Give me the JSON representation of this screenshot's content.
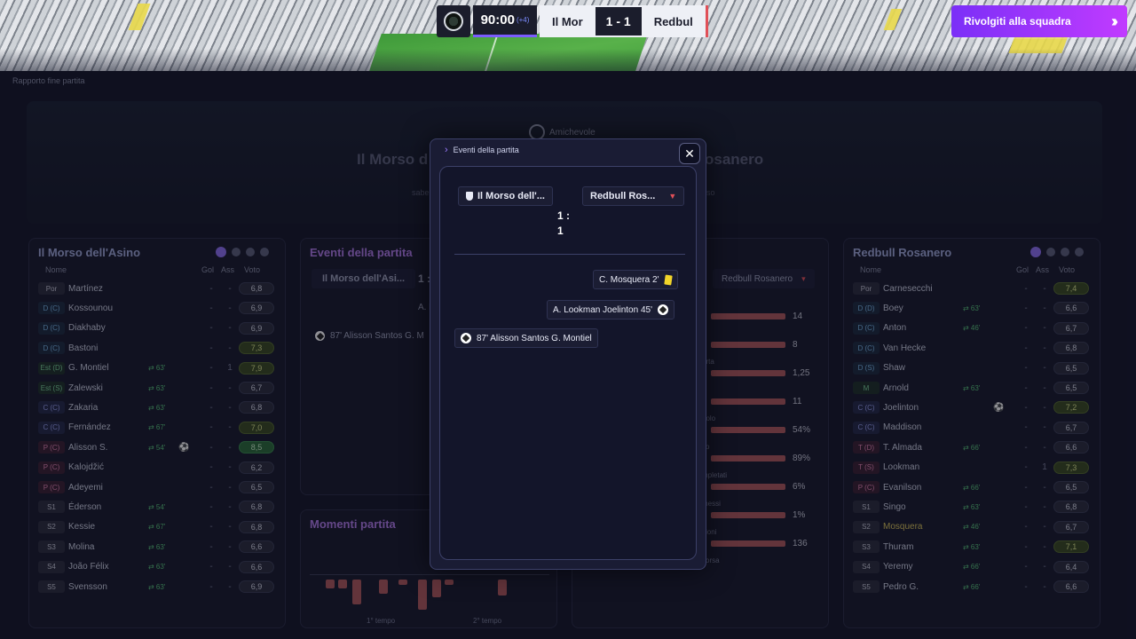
{
  "scoreboard": {
    "time": "90:00",
    "added": "(+4)",
    "home_short": "Il Mor",
    "score": "1 - 1",
    "away_short": "Redbul"
  },
  "talk_button": {
    "label": "Rivolgiti alla squadra",
    "icon": "double-chevron-right-icon"
  },
  "breadcrumb": "Rapporto fine partita",
  "hero": {
    "competition": "Amichevole",
    "title_left": "Il Morso d",
    "title_right": "osanero",
    "sub_left": "sabe",
    "sub_right": "so"
  },
  "home_panel": {
    "title": "Il Morso dell'Asino",
    "headers": {
      "name": "Nome",
      "goals": "Gol",
      "assists": "Ass",
      "rating": "Voto"
    },
    "players": [
      {
        "pos": "Por",
        "cls": "s",
        "name": "Martínez",
        "sub": "",
        "icon": "",
        "gol": "-",
        "ass": "-",
        "vote": "6,8",
        "vcls": ""
      },
      {
        "pos": "D (C)",
        "cls": "d",
        "name": "Kossounou",
        "sub": "",
        "icon": "",
        "gol": "-",
        "ass": "-",
        "vote": "6,9",
        "vcls": ""
      },
      {
        "pos": "D (C)",
        "cls": "d",
        "name": "Diakhaby",
        "sub": "",
        "icon": "",
        "gol": "-",
        "ass": "-",
        "vote": "6,9",
        "vcls": ""
      },
      {
        "pos": "D (C)",
        "cls": "d",
        "name": "Bastoni",
        "sub": "",
        "icon": "",
        "gol": "-",
        "ass": "-",
        "vote": "7,3",
        "vcls": "good"
      },
      {
        "pos": "Est (D)",
        "cls": "est",
        "name": "G. Montiel",
        "sub": "⇄ 63'",
        "icon": "",
        "gol": "-",
        "ass": "1",
        "vote": "7,9",
        "vcls": "good"
      },
      {
        "pos": "Est (S)",
        "cls": "est",
        "name": "Zalewski",
        "sub": "⇄ 63'",
        "icon": "",
        "gol": "-",
        "ass": "-",
        "vote": "6,7",
        "vcls": ""
      },
      {
        "pos": "C (C)",
        "cls": "c",
        "name": "Zakaria",
        "sub": "⇄ 63'",
        "icon": "",
        "gol": "-",
        "ass": "-",
        "vote": "6,8",
        "vcls": ""
      },
      {
        "pos": "C (C)",
        "cls": "c",
        "name": "Fernández",
        "sub": "⇄ 67'",
        "icon": "",
        "gol": "-",
        "ass": "-",
        "vote": "7,0",
        "vcls": "good"
      },
      {
        "pos": "P (C)",
        "cls": "p",
        "name": "Alisson S.",
        "sub": "⇄ 54'",
        "icon": "⚽",
        "gol": "-",
        "ass": "-",
        "vote": "8,5",
        "vcls": "great"
      },
      {
        "pos": "P (C)",
        "cls": "p",
        "name": "Kalojdžić",
        "sub": "",
        "icon": "",
        "gol": "-",
        "ass": "-",
        "vote": "6,2",
        "vcls": ""
      },
      {
        "pos": "P (C)",
        "cls": "p",
        "name": "Adeyemi",
        "sub": "",
        "icon": "",
        "gol": "-",
        "ass": "-",
        "vote": "6,5",
        "vcls": ""
      },
      {
        "pos": "S1",
        "cls": "s",
        "name": "Éderson",
        "sub": "⇄ 54'",
        "icon": "",
        "gol": "-",
        "ass": "-",
        "vote": "6,8",
        "vcls": ""
      },
      {
        "pos": "S2",
        "cls": "s",
        "name": "Kessie",
        "sub": "⇄ 67'",
        "icon": "",
        "gol": "-",
        "ass": "-",
        "vote": "6,8",
        "vcls": ""
      },
      {
        "pos": "S3",
        "cls": "s",
        "name": "Molina",
        "sub": "⇄ 63'",
        "icon": "",
        "gol": "-",
        "ass": "-",
        "vote": "6,6",
        "vcls": ""
      },
      {
        "pos": "S4",
        "cls": "s",
        "name": "João Félix",
        "sub": "⇄ 63'",
        "icon": "",
        "gol": "-",
        "ass": "-",
        "vote": "6,6",
        "vcls": ""
      },
      {
        "pos": "S5",
        "cls": "s",
        "name": "Svensson",
        "sub": "⇄ 63'",
        "icon": "",
        "gol": "-",
        "ass": "-",
        "vote": "6,9",
        "vcls": ""
      }
    ]
  },
  "away_panel": {
    "title": "Redbull Rosanero",
    "headers": {
      "name": "Nome",
      "goals": "Gol",
      "assists": "Ass",
      "rating": "Voto"
    },
    "players": [
      {
        "pos": "Por",
        "cls": "s",
        "name": "Carnesecchi",
        "sub": "",
        "icon": "",
        "gol": "-",
        "ass": "-",
        "vote": "7,4",
        "vcls": "good"
      },
      {
        "pos": "D (D)",
        "cls": "d",
        "name": "Boey",
        "sub": "⇄ 63'",
        "icon": "",
        "gol": "-",
        "ass": "-",
        "vote": "6,6",
        "vcls": ""
      },
      {
        "pos": "D (C)",
        "cls": "d",
        "name": "Anton",
        "sub": "⇄ 46'",
        "icon": "",
        "gol": "-",
        "ass": "-",
        "vote": "6,7",
        "vcls": ""
      },
      {
        "pos": "D (C)",
        "cls": "d",
        "name": "Van Hecke",
        "sub": "",
        "icon": "",
        "gol": "-",
        "ass": "-",
        "vote": "6,8",
        "vcls": ""
      },
      {
        "pos": "D (S)",
        "cls": "d",
        "name": "Shaw",
        "sub": "",
        "icon": "",
        "gol": "-",
        "ass": "-",
        "vote": "6,5",
        "vcls": ""
      },
      {
        "pos": "M",
        "cls": "m",
        "name": "Arnold",
        "sub": "⇄ 63'",
        "icon": "",
        "gol": "-",
        "ass": "-",
        "vote": "6,5",
        "vcls": ""
      },
      {
        "pos": "C (C)",
        "cls": "c",
        "name": "Joelinton",
        "sub": "",
        "icon": "⚽",
        "gol": "-",
        "ass": "-",
        "vote": "7,2",
        "vcls": "good"
      },
      {
        "pos": "C (C)",
        "cls": "c",
        "name": "Maddison",
        "sub": "",
        "icon": "",
        "gol": "-",
        "ass": "-",
        "vote": "6,7",
        "vcls": ""
      },
      {
        "pos": "T (D)",
        "cls": "t",
        "name": "T. Almada",
        "sub": "⇄ 66'",
        "icon": "",
        "gol": "-",
        "ass": "-",
        "vote": "6,6",
        "vcls": ""
      },
      {
        "pos": "T (S)",
        "cls": "t",
        "name": "Lookman",
        "sub": "",
        "icon": "",
        "gol": "-",
        "ass": "1",
        "vote": "7,3",
        "vcls": "good"
      },
      {
        "pos": "P (C)",
        "cls": "p",
        "name": "Evanilson",
        "sub": "⇄ 66'",
        "icon": "",
        "gol": "-",
        "ass": "-",
        "vote": "6,5",
        "vcls": ""
      },
      {
        "pos": "S1",
        "cls": "s",
        "name": "Singo",
        "sub": "⇄ 63'",
        "icon": "",
        "gol": "-",
        "ass": "-",
        "vote": "6,8",
        "vcls": ""
      },
      {
        "pos": "S2",
        "cls": "s",
        "name": "Mosquera",
        "sub": "⇄ 46'",
        "icon": "",
        "gol": "-",
        "ass": "-",
        "vote": "6,7",
        "vcls": "",
        "hl": true
      },
      {
        "pos": "S3",
        "cls": "s",
        "name": "Thuram",
        "sub": "⇄ 63'",
        "icon": "",
        "gol": "-",
        "ass": "-",
        "vote": "7,1",
        "vcls": "good"
      },
      {
        "pos": "S4",
        "cls": "s",
        "name": "Yeremy",
        "sub": "⇄ 66'",
        "icon": "",
        "gol": "-",
        "ass": "-",
        "vote": "6,4",
        "vcls": ""
      },
      {
        "pos": "S5",
        "cls": "s",
        "name": "Pedro G.",
        "sub": "⇄ 66'",
        "icon": "",
        "gol": "-",
        "ass": "-",
        "vote": "6,6",
        "vcls": ""
      }
    ]
  },
  "events_panel": {
    "title": "Eventi della partita",
    "home_team": "Il Morso dell'Asi...",
    "score_fragment": "1 :",
    "event_fragment_a": "A. l",
    "event_line": "87' Alisson Santos G. M"
  },
  "moments_panel": {
    "title": "Momenti partita",
    "first_half": "1° tempo",
    "second_half": "2° tempo"
  },
  "stats_panel": {
    "away_team": "Redbull Rosanero",
    "rows": [
      {
        "value": "14",
        "label": ""
      },
      {
        "value": "8",
        "label": "orta"
      },
      {
        "value": "1,25",
        "label": ""
      },
      {
        "value": "11",
        "label": "golo"
      },
      {
        "value": "54%",
        "label": "so"
      },
      {
        "value": "89%",
        "label": "mpletati"
      },
      {
        "value": "6%",
        "label": "messi"
      },
      {
        "value": "1%",
        "label": "zioni"
      },
      {
        "value": "136",
        "label": "corsa"
      }
    ]
  },
  "modal": {
    "header": "Eventi della partita",
    "home_team": "Il Morso dell'...",
    "away_team": "Redbull Ros...",
    "score_top": "1 :",
    "score_bottom": "1",
    "events": [
      {
        "text": "C. Mosquera 2'",
        "type": "yellow-card"
      },
      {
        "text": "A. Lookman Joelinton 45'",
        "type": "goal"
      },
      {
        "text": "87' Alisson Santos G. Montiel",
        "type": "goal"
      }
    ]
  }
}
